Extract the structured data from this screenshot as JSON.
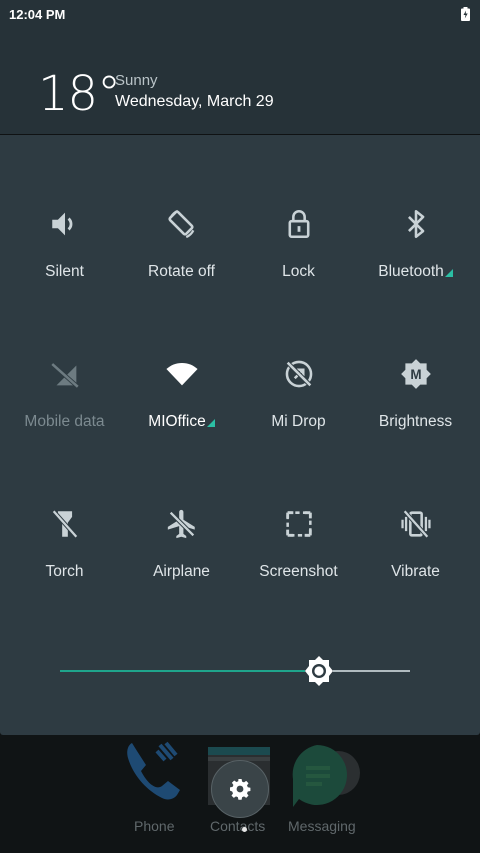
{
  "status_bar": {
    "time": "12:04 PM",
    "battery_icon": "battery-charging-icon"
  },
  "weather": {
    "temperature": "18°",
    "condition": "Sunny",
    "date": "Wednesday, March 29"
  },
  "tiles": [
    {
      "label": "Silent",
      "icon": "volume-icon",
      "state": "on"
    },
    {
      "label": "Rotate off",
      "icon": "rotate-icon",
      "state": "on"
    },
    {
      "label": "Lock",
      "icon": "lock-icon",
      "state": "on"
    },
    {
      "label": "Bluetooth",
      "icon": "bluetooth-icon",
      "state": "on",
      "has_menu": true
    },
    {
      "label": "Mobile data",
      "icon": "mobile-data-off-icon",
      "state": "disabled"
    },
    {
      "label": "MIOffice",
      "icon": "wifi-icon",
      "state": "active",
      "has_menu": true
    },
    {
      "label": "Mi Drop",
      "icon": "mi-drop-icon",
      "state": "on"
    },
    {
      "label": "Brightness",
      "icon": "brightness-auto-icon",
      "state": "on"
    },
    {
      "label": "Torch",
      "icon": "torch-icon",
      "state": "on"
    },
    {
      "label": "Airplane",
      "icon": "airplane-icon",
      "state": "on"
    },
    {
      "label": "Screenshot",
      "icon": "screenshot-icon",
      "state": "on"
    },
    {
      "label": "Vibrate",
      "icon": "vibrate-icon",
      "state": "on"
    }
  ],
  "brightness": {
    "level": 0.74,
    "accent": "#1fa58c"
  },
  "dock": [
    {
      "label": "Phone",
      "icon": "phone-icon"
    },
    {
      "label": "Contacts",
      "icon": "contacts-icon"
    },
    {
      "label": "Messaging",
      "icon": "messaging-icon"
    }
  ],
  "colors": {
    "panel": "#2e3b42",
    "header": "#263238",
    "accent": "#2bbfa4",
    "icon": "#c9d2d6"
  }
}
